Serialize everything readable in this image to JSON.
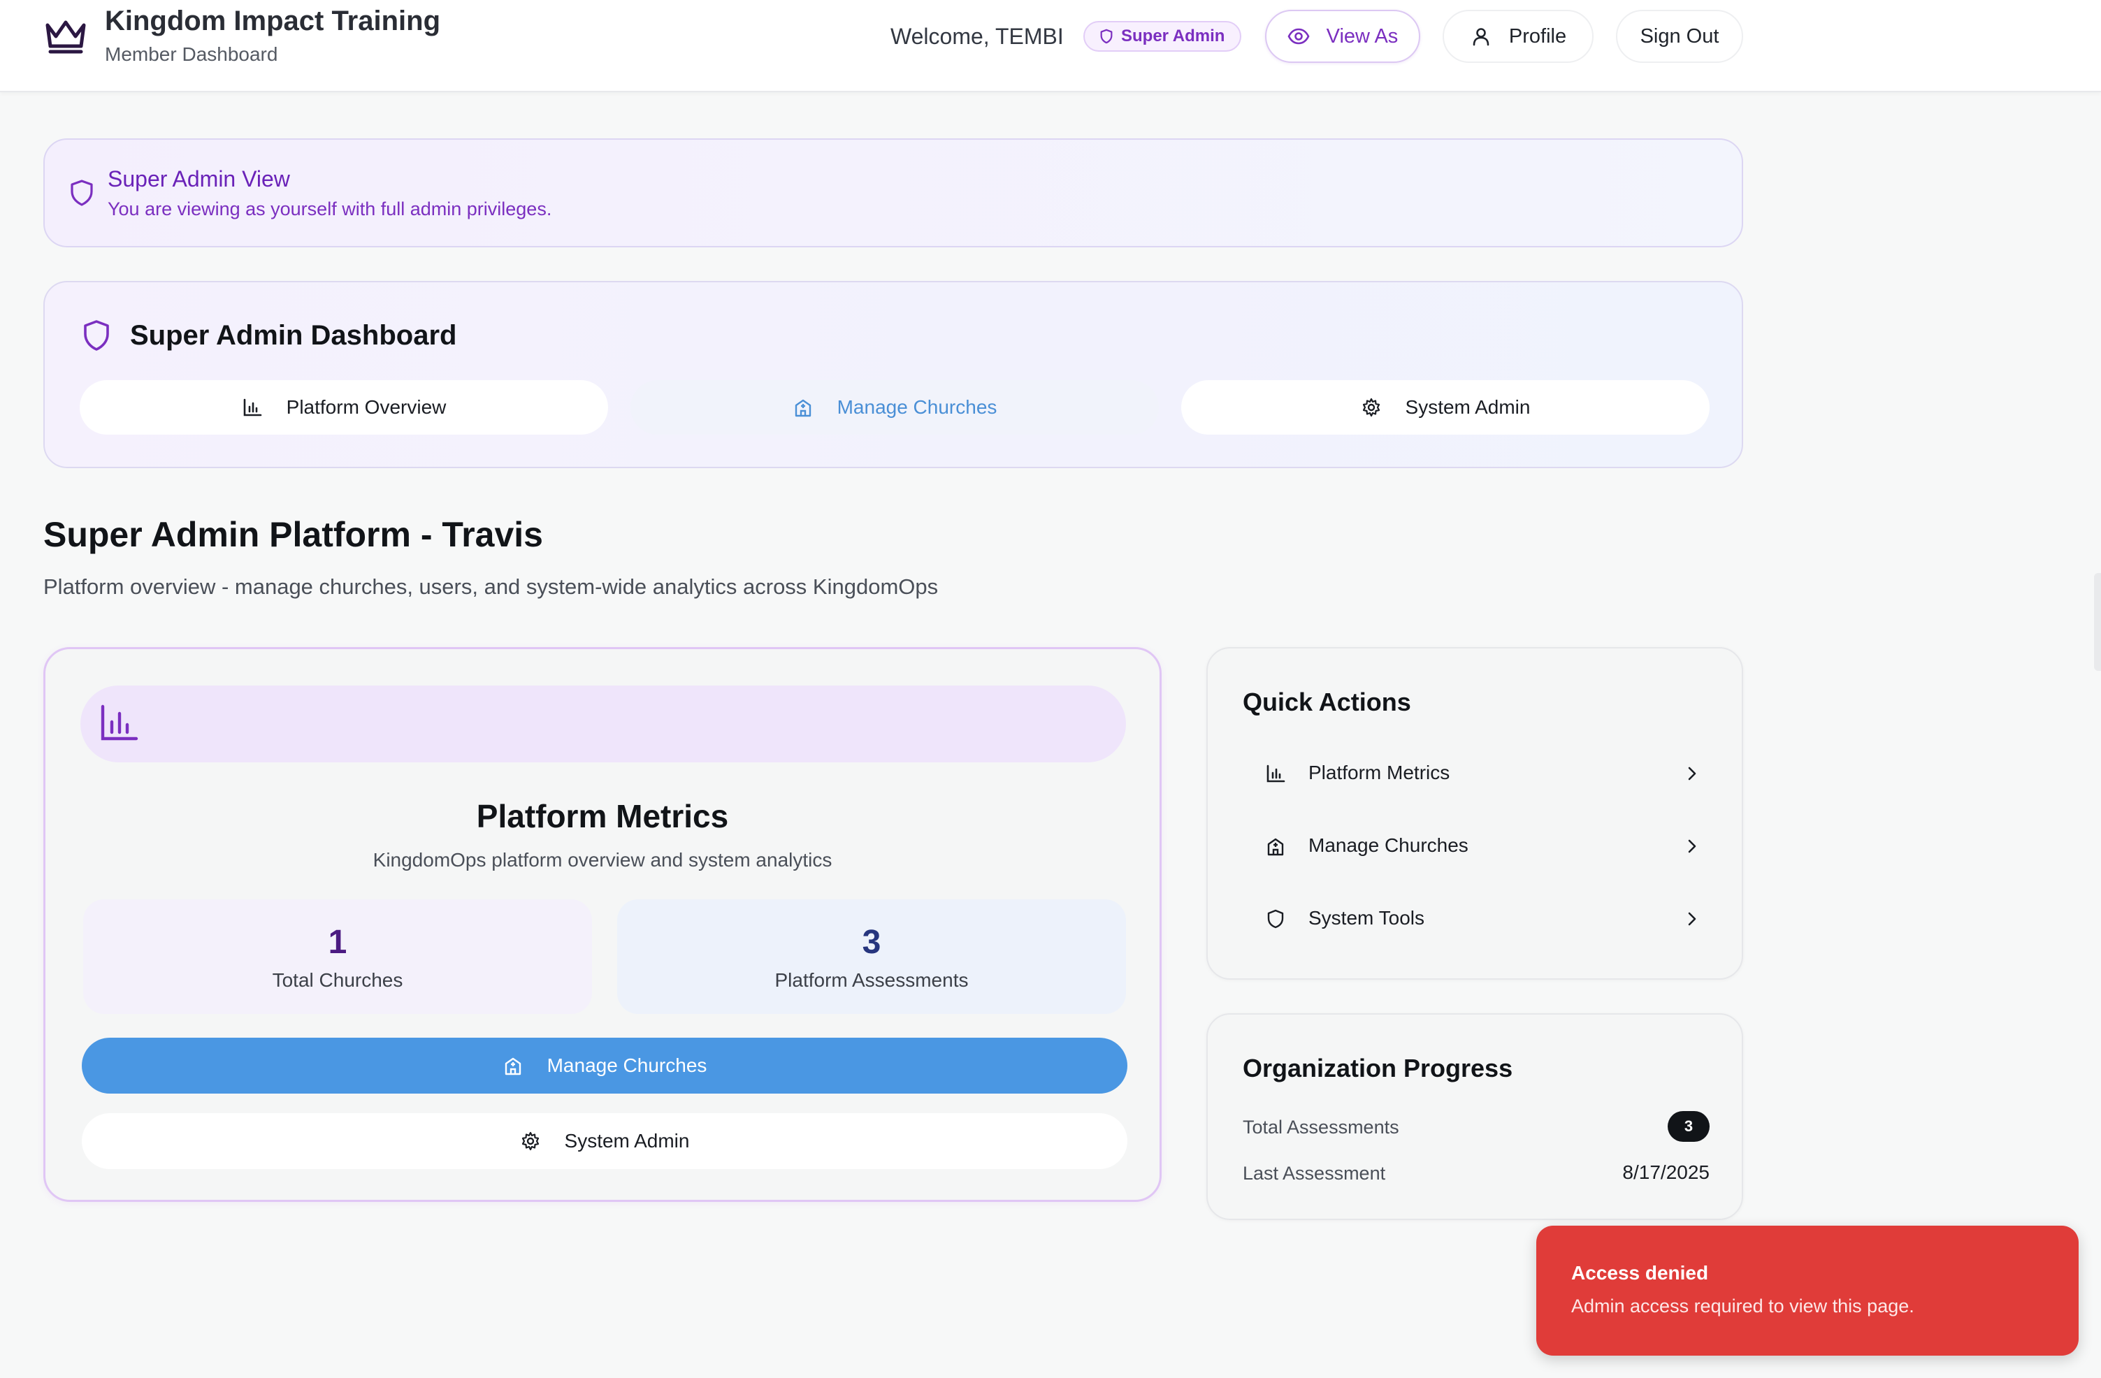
{
  "header": {
    "app_title": "Kingdom Impact Training",
    "app_subtitle": "Member Dashboard",
    "welcome": "Welcome, TEMBI",
    "role_badge": "Super Admin",
    "view_as_label": "View As",
    "profile_label": "Profile",
    "sign_out_label": "Sign Out",
    "logo_icon": "crown-icon"
  },
  "banner": {
    "title": "Super Admin View",
    "text": "You are viewing as yourself with full admin privileges.",
    "icon": "shield-icon"
  },
  "super_admin_dashboard": {
    "title": "Super Admin Dashboard",
    "tabs": [
      {
        "label": "Platform Overview",
        "icon": "bar-chart-icon",
        "active": false
      },
      {
        "label": "Manage Churches",
        "icon": "church-icon",
        "active": true
      },
      {
        "label": "System Admin",
        "icon": "gear-icon",
        "active": false
      }
    ]
  },
  "page": {
    "title": "Super Admin Platform - Travis",
    "description": "Platform overview - manage churches, users, and system-wide analytics across KingdomOps"
  },
  "metrics": {
    "title": "Platform Metrics",
    "subtitle": "KingdomOps platform overview and system analytics",
    "stats": [
      {
        "value": "1",
        "label": "Total Churches"
      },
      {
        "value": "3",
        "label": "Platform Assessments"
      }
    ],
    "primary_button": "Manage Churches",
    "secondary_button": "System Admin"
  },
  "quick_actions": {
    "title": "Quick Actions",
    "items": [
      {
        "label": "Platform Metrics",
        "icon": "bar-chart-icon"
      },
      {
        "label": "Manage Churches",
        "icon": "church-icon"
      },
      {
        "label": "System Tools",
        "icon": "shield-icon"
      }
    ]
  },
  "organization_progress": {
    "title": "Organization Progress",
    "total_assessments_label": "Total Assessments",
    "total_assessments_value": "3",
    "last_assessment_label": "Last Assessment",
    "last_assessment_value": "8/17/2025"
  },
  "toast": {
    "title": "Access denied",
    "message": "Admin access required to view this page."
  },
  "colors": {
    "accent_purple": "#7b2fc0",
    "primary_blue": "#4a97e3",
    "toast_red": "#e03c39"
  }
}
